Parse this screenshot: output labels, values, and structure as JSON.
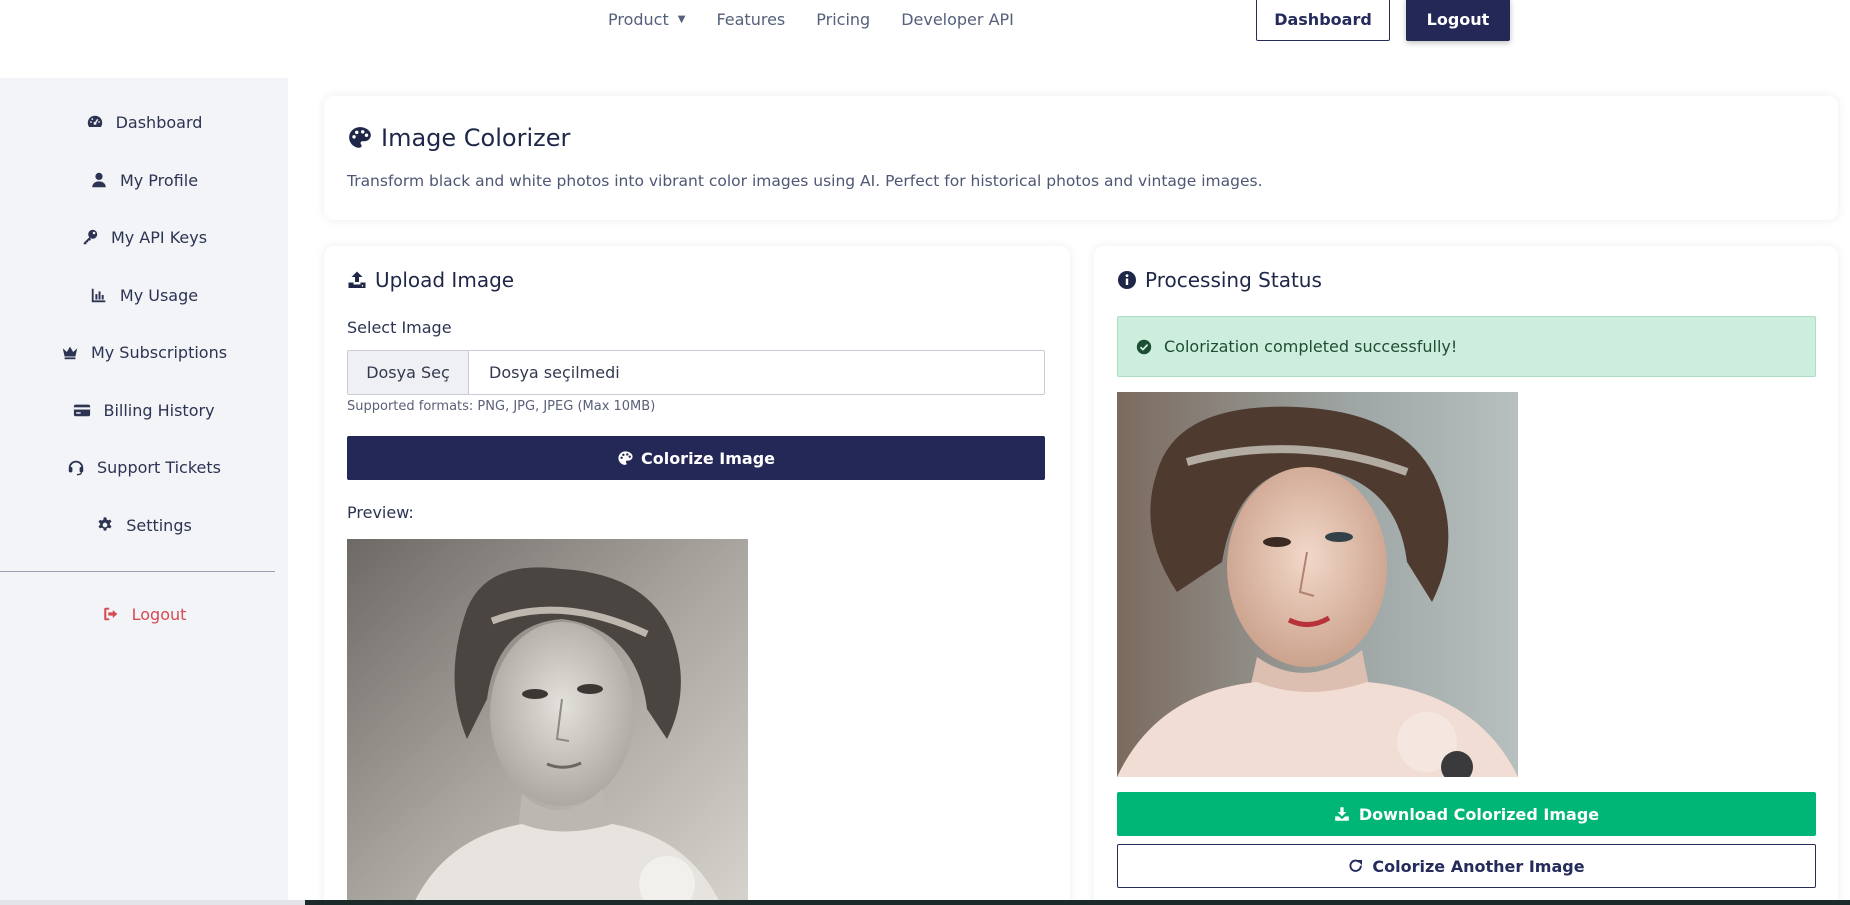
{
  "topnav": {
    "links": [
      {
        "label": "Product"
      },
      {
        "label": "Features"
      },
      {
        "label": "Pricing"
      },
      {
        "label": "Developer API"
      }
    ],
    "dashboard_label": "Dashboard",
    "logout_label": "Logout"
  },
  "sidebar": {
    "items": [
      {
        "label": "Dashboard",
        "icon": "gauge-icon"
      },
      {
        "label": "My Profile",
        "icon": "user-icon"
      },
      {
        "label": "My API Keys",
        "icon": "key-icon"
      },
      {
        "label": "My Usage",
        "icon": "chart-icon"
      },
      {
        "label": "My Subscriptions",
        "icon": "crown-icon"
      },
      {
        "label": "Billing History",
        "icon": "credit-card-icon"
      },
      {
        "label": "Support Tickets",
        "icon": "headset-icon"
      },
      {
        "label": "Settings",
        "icon": "gear-icon"
      }
    ],
    "logout_label": "Logout"
  },
  "header": {
    "title": "Image Colorizer",
    "description": "Transform black and white photos into vibrant color images using AI. Perfect for historical photos and vintage images."
  },
  "upload": {
    "title": "Upload Image",
    "select_label": "Select Image",
    "file_button": "Dosya Seç",
    "file_status": "Dosya seçilmedi",
    "formats": "Supported formats: PNG, JPG, JPEG (Max 10MB)",
    "colorize_button": "Colorize Image",
    "preview_label": "Preview:"
  },
  "processing": {
    "title": "Processing Status",
    "success_message": "Colorization completed successfully!",
    "download_button": "Download Colorized Image",
    "another_button": "Colorize Another Image"
  },
  "colors": {
    "primary": "#232856",
    "success": "#00b676",
    "alert_bg": "#cdeedd",
    "danger": "#d64a52",
    "sidebar_bg": "#f3f4f8"
  }
}
